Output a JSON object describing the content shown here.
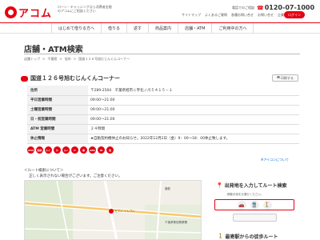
{
  "header": {
    "logo_text": "アコム",
    "tagline": "ローン・キャッシングなら消費者金融のアコムにご相談ください",
    "phone_label": "電話でのご相談",
    "phone_number": "0120-07-1000",
    "links": [
      "サイトマップ",
      "よくあるご質問",
      "各種お問い合せ",
      "お問い合せ",
      "企業情報サイト"
    ],
    "login_label": "ログイン"
  },
  "nav": {
    "items": [
      "はじめて借りる方へ",
      "借りる",
      "返す",
      "商品案内",
      "店舗・ATM",
      "ご利用中の方へ"
    ]
  },
  "page": {
    "title": "店舗・ATM検索",
    "breadcrumb": [
      "店舗トップ",
      "千葉県",
      "旭市",
      "国道１２６号旭むじんくんコーナー"
    ]
  },
  "store": {
    "name": "国道１２６号旭むじんくんコーナー",
    "print_label": "印刷する",
    "rows": [
      {
        "key": "住所",
        "value": "〒289-2504　千葉県旭市ニ字北ノ爪５４１５－１"
      },
      {
        "key": "平日営業時間",
        "value": "09:00～21:00"
      },
      {
        "key": "土曜営業時間",
        "value": "09:00～21:00"
      },
      {
        "key": "日・祝営業時間",
        "value": "09:00～21:00"
      },
      {
        "key": "ATM 営業時間",
        "value": "２４時間"
      },
      {
        "key": "休止情報",
        "value": "★自動契約機休止のお知らせ。2022年12月2日（金）9：00～18：00休止致します。"
      }
    ],
    "icon_note": "※アイコンについて"
  },
  "services": [
    {
      "name": "atm",
      "label": "ATM",
      "color": "#e60012"
    },
    {
      "name": "contract",
      "label": "契約",
      "color": "#e60012"
    },
    {
      "name": "card",
      "label": "ｶｰﾄﾞ",
      "color": "#e60012"
    },
    {
      "name": "credit",
      "label": "ｸﾚ",
      "color": "#e60012"
    },
    {
      "name": "loan",
      "label": "ﾛｰﾝ",
      "color": "#e60012"
    },
    {
      "name": "parking",
      "label": "P",
      "color": "#e60012"
    },
    {
      "name": "accessible",
      "label": "車",
      "color": "#e60012"
    },
    {
      "name": "aed",
      "label": "AED",
      "color": "#e60012"
    },
    {
      "name": "wifi",
      "label": "W",
      "color": "#e60012"
    },
    {
      "name": "other",
      "label": "他",
      "color": "#e60012"
    }
  ],
  "route_note": {
    "title": "＜ルート検索について＞",
    "text": "正しく表示されない場合がございます。ご注意ください。"
  },
  "map": {
    "labels": [
      "セブン-イレブン",
      "鎌数",
      "千葉県警旭警察署"
    ]
  },
  "route_panel": {
    "title": "出発地を入力してルート検索",
    "subtitle": "移動手段をお選びください。",
    "modes": [
      "car-icon",
      "train-icon",
      "walk-icon"
    ],
    "bottom_heading": "最寄駅からの徒歩ルート"
  },
  "colors": {
    "brand": "#e60012"
  }
}
